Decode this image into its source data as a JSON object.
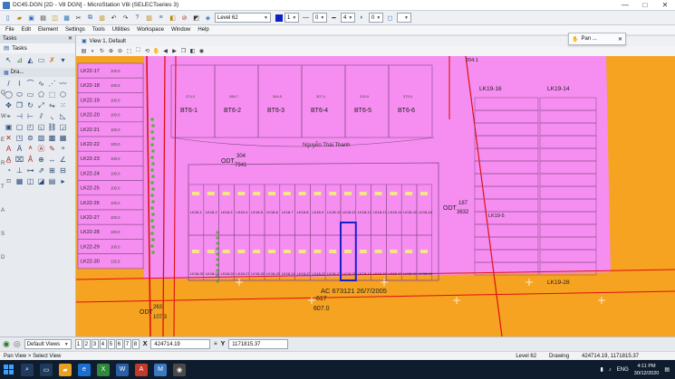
{
  "window": {
    "title": "DC45.DGN [2D - V8 DGN] - MicroStation V8i (SELECTseries 3)",
    "controls": [
      "—",
      "□",
      "✕"
    ]
  },
  "toolbar": {
    "level": "Level 62",
    "color_value": "1",
    "style_value": "0",
    "weight_value": "4",
    "transparency_value": "0"
  },
  "menu": [
    "File",
    "Edit",
    "Element",
    "Settings",
    "Tools",
    "Utilities",
    "Workspace",
    "Window",
    "Help"
  ],
  "tasks": {
    "title": "Tasks",
    "search": "Tasks",
    "section": "Dra...",
    "letters": [
      "Q",
      "W",
      "E",
      "R",
      "T",
      "A",
      "S",
      "D"
    ]
  },
  "view": {
    "title": "View 1, Default"
  },
  "float_window": {
    "title": "Pan ..."
  },
  "status": {
    "views_label": "Default Views",
    "view_numbers": [
      "1",
      "2",
      "3",
      "4",
      "5",
      "6",
      "7",
      "8"
    ],
    "x_label": "X",
    "x_value": "424714.19",
    "y_label": "Y",
    "y_value": "1171815.37"
  },
  "prompt": {
    "left": "Pan View > Select View",
    "level": "Level 62",
    "mode": "Drawing",
    "coords": "424714.19, 1171815.37"
  },
  "taskbar": {
    "lang": "ENG",
    "time": "4:11 PM",
    "date": "30/12/2020"
  },
  "map": {
    "colors": {
      "pink": "#f58ef0",
      "orange": "#f5a320",
      "red": "#e01010",
      "green": "#4fb53a",
      "blue": "#1a20c8",
      "grid": "#8a4a8a"
    },
    "left_lots": [
      "LK22-17",
      "LK22-18",
      "LK22-19",
      "LK22-20",
      "LK22-21",
      "LK22-22",
      "LK22-23",
      "LK22-24",
      "LK22-25",
      "LK22-26",
      "LK22-27",
      "LK22-28",
      "LK22-29",
      "LK22-30"
    ],
    "left_areas": [
      "102.0",
      "100.6",
      "100.0",
      "100.0",
      "100.0",
      "100.0",
      "100.0",
      "100.0",
      "100.0",
      "100.0",
      "100.0",
      "100.0",
      "100.0",
      "132.6"
    ],
    "bt_blocks": [
      "BT6-1",
      "BT6-2",
      "BT6-3",
      "BT6-4",
      "BT6-5",
      "BT6-6"
    ],
    "bt_areas": [
      "374.0",
      "288.7",
      "364.5",
      "307.4",
      "315.9",
      "375.0"
    ],
    "row_upper_labels": [
      "LK18-1",
      "LK18-2",
      "LK18-3",
      "LK18-4",
      "LK18-5",
      "LK18-6",
      "LK18-7",
      "LK18-8",
      "LK18-9",
      "LK18-10",
      "LK18-11",
      "LK18-12",
      "LK18-13",
      "LK18-14",
      "LK18-15",
      "LK18-16"
    ],
    "row_lower_labels": [
      "LK18-30",
      "LK18-29",
      "LK18-28",
      "LK18-27",
      "LK18-26",
      "LK18-25",
      "LK18-24",
      "LK18-23",
      "LK18-22",
      "LK18-21",
      "LK18-20",
      "LK18-19",
      "LK18-18",
      "LK18-17",
      "LK18-16",
      "LK18-15"
    ],
    "right_header_lots": [
      "LK19-16",
      "LK19-14"
    ],
    "right_lots_bottom": "LK19-28",
    "right_mid_label": "LK19-5",
    "odt_top": {
      "code": "ODT",
      "number": "304",
      "area": "7941"
    },
    "odt_mid": {
      "code": "ODT",
      "number": "187",
      "area": "3632"
    },
    "odt_bottom": {
      "code": "ODT",
      "number": "263",
      "area": "107.3"
    },
    "plot_617": {
      "number": "617",
      "area": "607.0"
    },
    "note": "AC 673121 26/7/2005",
    "road_label": "204.1",
    "handwritten": "Nguyễn Thái Thanh"
  }
}
